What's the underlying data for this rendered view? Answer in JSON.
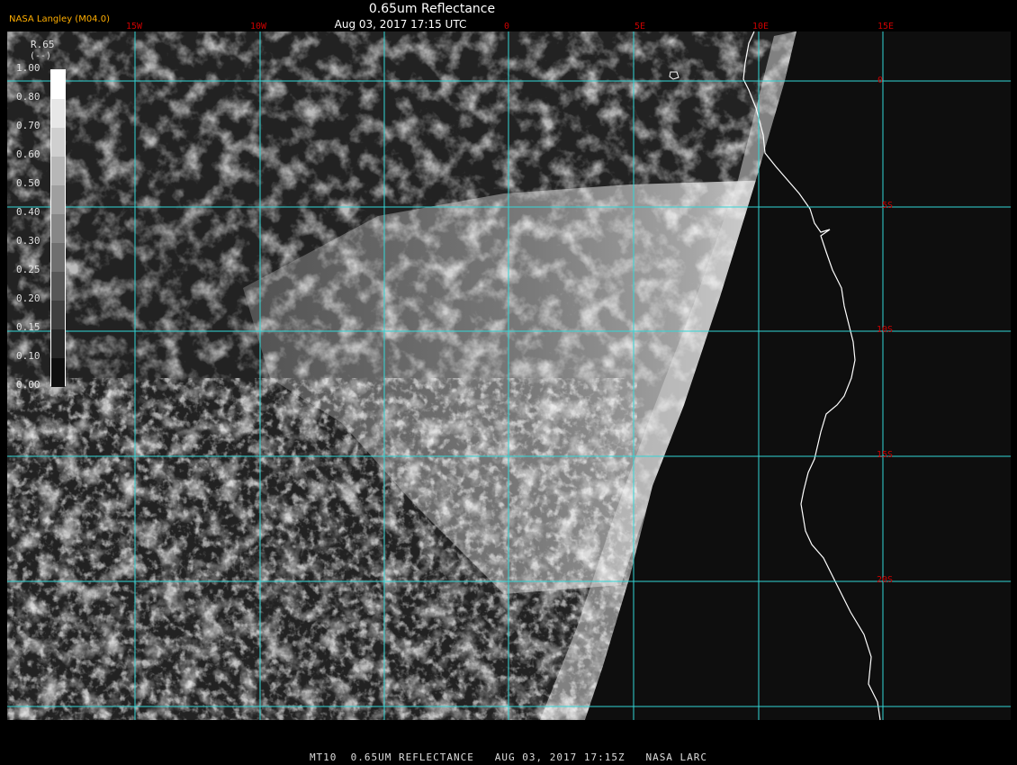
{
  "header": {
    "title": "0.65um Reflectance",
    "datetime": "Aug 03, 2017 17:15 UTC",
    "brand": "NASA Langley (M04.0)"
  },
  "footer": {
    "caption": "MT10  0.65UM REFLECTANCE   AUG 03, 2017 17:15Z   NASA LARC"
  },
  "grid": {
    "longitude_labels": [
      "15W",
      "10W",
      "0",
      "5E",
      "10E",
      "15E"
    ],
    "latitude_labels": [
      "0",
      "5S",
      "10S",
      "15S",
      "20S"
    ],
    "color": "#33d6d6",
    "label_color": "#cc0000"
  },
  "colorbar": {
    "title": "R.65",
    "unit": "(--)",
    "ticks": [
      "1.00",
      "0.80",
      "0.70",
      "0.60",
      "0.50",
      "0.40",
      "0.30",
      "0.25",
      "0.20",
      "0.15",
      "0.10",
      "0.00"
    ]
  },
  "colors": {
    "background": "#000000",
    "ocean": "#1c1c1c",
    "land": "#0a0a0a",
    "coastline": "#ffffff",
    "brand": "#ffae00"
  }
}
